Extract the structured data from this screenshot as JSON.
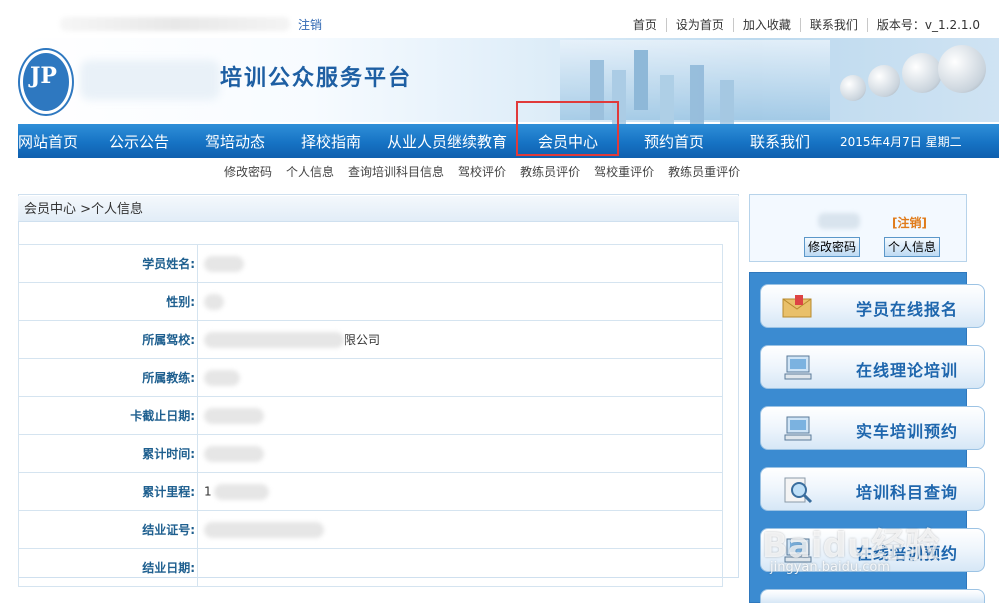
{
  "topbar": {
    "logout_link": "注销",
    "links": [
      "首页",
      "设为首页",
      "加入收藏",
      "联系我们",
      "版本号：v_1.2.1.0"
    ]
  },
  "banner": {
    "title": "培训公众服务平台",
    "logo_text": "JP"
  },
  "mainnav": {
    "items": [
      "网站首页",
      "公示公告",
      "驾培动态",
      "择校指南",
      "从业人员继续教育",
      "会员中心",
      "预约首页",
      "联系我们"
    ],
    "date": "2015年4月7日  星期二",
    "active_index": 5
  },
  "subnav": [
    "修改密码",
    "个人信息",
    "查询培训科目信息",
    "驾校评价",
    "教练员评价",
    "驾校重评价",
    "教练员重评价"
  ],
  "breadcrumb": "会员中心 >个人信息",
  "profile": {
    "rows": [
      {
        "label": "学员姓名:",
        "value": ""
      },
      {
        "label": "性别:",
        "value": ""
      },
      {
        "label": "所属驾校:",
        "value": "限公司"
      },
      {
        "label": "所属教练:",
        "value": ""
      },
      {
        "label": "卡截止日期:",
        "value": ""
      },
      {
        "label": "累计时间:",
        "value": ""
      },
      {
        "label": "累计里程:",
        "value": "1"
      },
      {
        "label": "结业证号:",
        "value": ""
      },
      {
        "label": "结业日期:",
        "value": ""
      }
    ]
  },
  "userbox": {
    "logout": "[注销]",
    "change_password": "修改密码",
    "personal_info": "个人信息"
  },
  "sidebar": {
    "buttons": [
      "学员在线报名",
      "在线理论培训",
      "实车培训预约",
      "培训科目查询",
      "在线培训预约"
    ]
  },
  "watermark": {
    "main": "Baidu经验",
    "sub": "jingyan.baidu.com"
  },
  "colors": {
    "nav_blue": "#1673c4",
    "label_blue": "#1e5f8f",
    "highlight_red": "#e03a3a",
    "sidebar_blue": "#3b8bd1"
  }
}
